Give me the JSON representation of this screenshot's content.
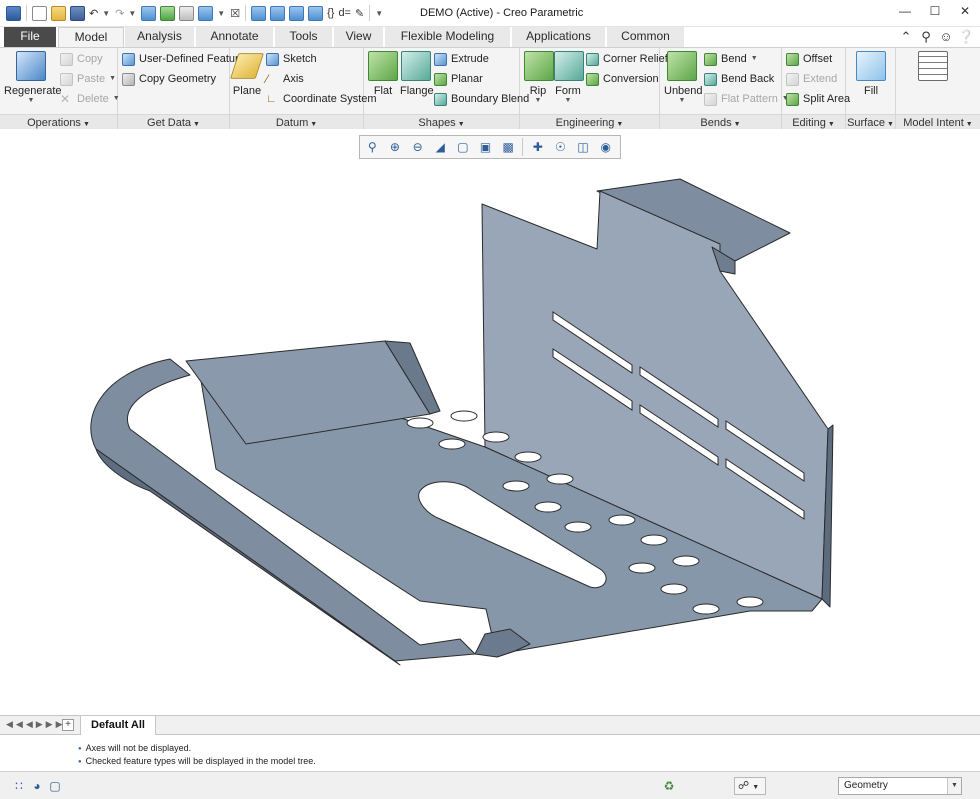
{
  "app": {
    "window_title": "DEMO (Active) - Creo Parametric"
  },
  "quick_access": {
    "items": [
      "app-icon",
      "new-icon",
      "open-icon",
      "save-icon",
      "undo-icon",
      "redo-icon",
      "regenerate-icon",
      "window-icon",
      "close-window-icon",
      "datum-display-icon"
    ],
    "sketch_view_label": "{}",
    "relations_label": "d="
  },
  "tabs": [
    {
      "label": "File"
    },
    {
      "label": "Model"
    },
    {
      "label": "Analysis"
    },
    {
      "label": "Annotate"
    },
    {
      "label": "Tools"
    },
    {
      "label": "View"
    },
    {
      "label": "Flexible Modeling"
    },
    {
      "label": "Applications"
    },
    {
      "label": "Common"
    }
  ],
  "ribbon": {
    "operations": {
      "label": "Operations",
      "regenerate": "Regenerate",
      "copy": "Copy",
      "paste": "Paste",
      "delete": "Delete"
    },
    "get_data": {
      "label": "Get Data",
      "udf": "User-Defined Feature",
      "copy_geometry": "Copy Geometry"
    },
    "datum": {
      "label": "Datum",
      "plane": "Plane",
      "sketch": "Sketch",
      "axis": "Axis",
      "csys": "Coordinate System"
    },
    "shapes": {
      "label": "Shapes",
      "flat": "Flat",
      "flange": "Flange",
      "extrude": "Extrude",
      "planar": "Planar",
      "boundary_blend": "Boundary Blend"
    },
    "engineering": {
      "label": "Engineering",
      "rip": "Rip",
      "form": "Form",
      "corner_relief": "Corner Relief",
      "conversion": "Conversion"
    },
    "bends": {
      "label": "Bends",
      "unbend": "Unbend",
      "bend": "Bend",
      "bend_back": "Bend Back",
      "flat_pattern": "Flat Pattern"
    },
    "editing": {
      "label": "Editing",
      "offset": "Offset",
      "extend": "Extend",
      "split_area": "Split Area"
    },
    "surface": {
      "label": "Surface",
      "fill": "Fill"
    },
    "model_intent": {
      "label": "Model Intent"
    }
  },
  "view_toolbar": {
    "items": [
      "refit-icon",
      "zoom-in-icon",
      "zoom-out-icon",
      "repaint-icon",
      "display-style-icon",
      "saved-orientations-icon",
      "view-manager-icon",
      "datum-display-icon",
      "spin-center-icon",
      "annotation-display-icon",
      "appearance-icon"
    ]
  },
  "model_tree_bar": {
    "tab_label": "Default All"
  },
  "messages": [
    "Axes will not be displayed.",
    "Checked feature types will be displayed in the model tree."
  ],
  "status_bar": {
    "filter_value": "Geometry"
  },
  "colors": {
    "part_fill": "#8e9cae",
    "part_edge": "#2b2b2b",
    "file_tab": "#4a4a4a"
  }
}
